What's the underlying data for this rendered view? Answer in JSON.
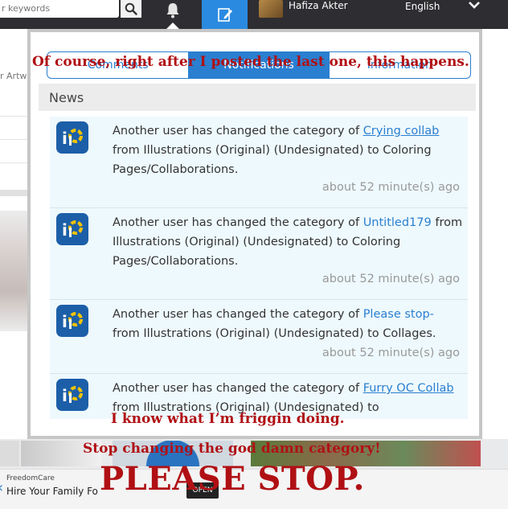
{
  "topbar": {
    "search_placeholder": "r keywords",
    "username": "Hafiza Akter",
    "language": "English"
  },
  "background": {
    "artwork_label": "r Artw"
  },
  "modal": {
    "tabs": [
      {
        "label": "Comments"
      },
      {
        "label": "Notifications"
      },
      {
        "label": "Information"
      }
    ],
    "news_header": "News",
    "items": [
      {
        "text_before": "Another user has changed the category of ",
        "link": "Crying collab",
        "text_after": " from Illustrations (Original) (Undesignated) to Coloring Pages/Collaborations.",
        "time": "about 52 minute(s) ago"
      },
      {
        "text_before": "Another user has changed the category of ",
        "link": "Untitled179",
        "text_after": " from Illustrations (Original) (Undesignated) to Coloring Pages/Collaborations.",
        "time": "about 52 minute(s) ago"
      },
      {
        "text_before": "Another user has changed the category of ",
        "link": "Please stop-",
        "text_after": " from Illustrations (Original) (Undesignated) to Collages.",
        "time": "about 52 minute(s) ago"
      },
      {
        "text_before": "Another user has changed the category of ",
        "link": "Furry OC Collab",
        "text_after": " from Illustrations (Original) (Undesignated) to",
        "time": ""
      }
    ]
  },
  "ad": {
    "brand": "FreedomCare",
    "text": "Hire Your Family Fo",
    "open_label": "OPEN"
  },
  "captions": {
    "top": "Of course, right after I posted the last one, this happens.",
    "middle": "I know what I’m friggin doing.",
    "lower": "Stop changing the god damn category!",
    "big": "PLEASE STOP."
  },
  "colors": {
    "accent": "#2a7fd0",
    "caption": "#b01014",
    "topbar": "#2e2e32"
  }
}
